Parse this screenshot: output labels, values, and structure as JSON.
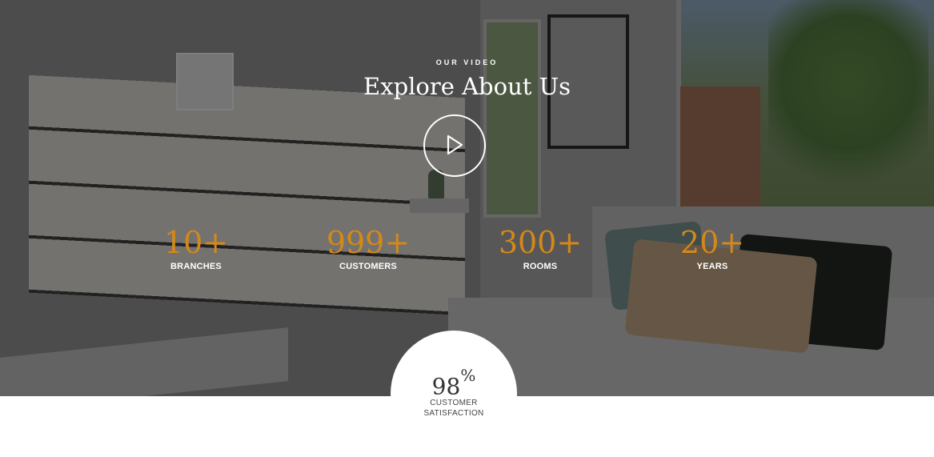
{
  "hero": {
    "eyebrow": "OUR VIDEO",
    "title": "Explore About Us",
    "play_icon": "play-icon"
  },
  "stats": [
    {
      "value": "10+",
      "label": "BRANCHES"
    },
    {
      "value": "999+",
      "label": "CUSTOMERS"
    },
    {
      "value": "300+",
      "label": "ROOMS"
    },
    {
      "value": "20+",
      "label": "YEARS"
    }
  ],
  "satisfaction": {
    "value": "98",
    "unit": "%",
    "label": "CUSTOMER SATISFACTION"
  },
  "colors": {
    "accent": "#d4881a",
    "text_light": "#ffffff",
    "overlay": "#000000"
  }
}
